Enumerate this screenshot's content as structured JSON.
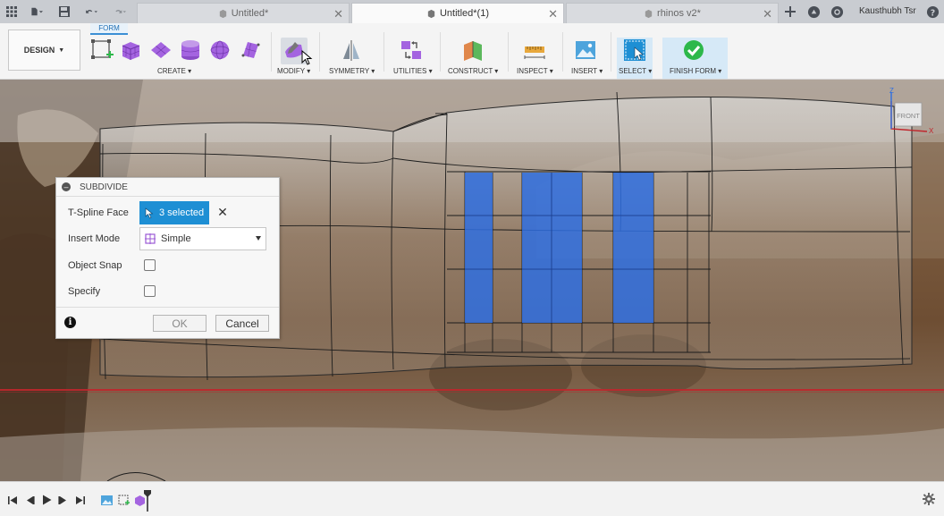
{
  "tabs": [
    {
      "label": "Untitled*",
      "active": false
    },
    {
      "label": "Untitled*(1)",
      "active": true
    },
    {
      "label": "rhinos v2*",
      "active": false
    }
  ],
  "user": {
    "name": "Kausthubh Tsr"
  },
  "ribbon": {
    "workspace": "DESIGN",
    "active_tab": "FORM",
    "groups": [
      "CREATE",
      "MODIFY",
      "SYMMETRY",
      "UTILITIES",
      "CONSTRUCT",
      "INSPECT",
      "INSERT",
      "SELECT",
      "FINISH FORM"
    ]
  },
  "viewcube": {
    "face": "FRONT",
    "axis_z": "Z",
    "axis_x": "X"
  },
  "dialog": {
    "title": "SUBDIVIDE",
    "rows": {
      "tspline_face": {
        "label": "T-Spline Face",
        "value": "3 selected"
      },
      "insert_mode": {
        "label": "Insert Mode",
        "value": "Simple"
      },
      "object_snap": {
        "label": "Object Snap",
        "checked": false
      },
      "specify": {
        "label": "Specify",
        "checked": false
      }
    },
    "ok_label": "OK",
    "cancel_label": "Cancel"
  },
  "colors": {
    "accent": "#1e8fd4",
    "selection_face": "#2f6fe0",
    "form_purple": "#9b59d6",
    "finish_green": "#2db84a"
  }
}
